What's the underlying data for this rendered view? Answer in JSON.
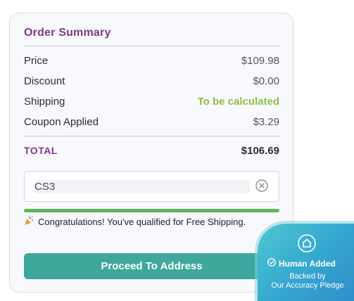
{
  "summary": {
    "title": "Order Summary",
    "rows": [
      {
        "label": "Price",
        "value": "$109.98"
      },
      {
        "label": "Discount",
        "value": "$0.00"
      },
      {
        "label": "Shipping",
        "value": "To be calculated"
      },
      {
        "label": "Coupon Applied",
        "value": "$3.29"
      }
    ],
    "total": {
      "label": "TOTAL",
      "value": "$106.69"
    }
  },
  "coupon": {
    "value": "CS3",
    "clear_icon": "close-circle-icon"
  },
  "shipping_progress": 1.0,
  "congrats": {
    "icon": "party-popper-icon",
    "text": "Congratulations! You've qualified for Free Shipping."
  },
  "proceed_button": "Proceed To Address",
  "badge": {
    "icon": "shield-check-icon",
    "line1": "Human Added",
    "line2": "Backed by",
    "line3": "Our Accuracy Pledge"
  },
  "colors": {
    "accent": "#7b3a83",
    "button": "#3fa79b",
    "shipping_text": "#8fbf45",
    "progress": "#5db55b"
  }
}
